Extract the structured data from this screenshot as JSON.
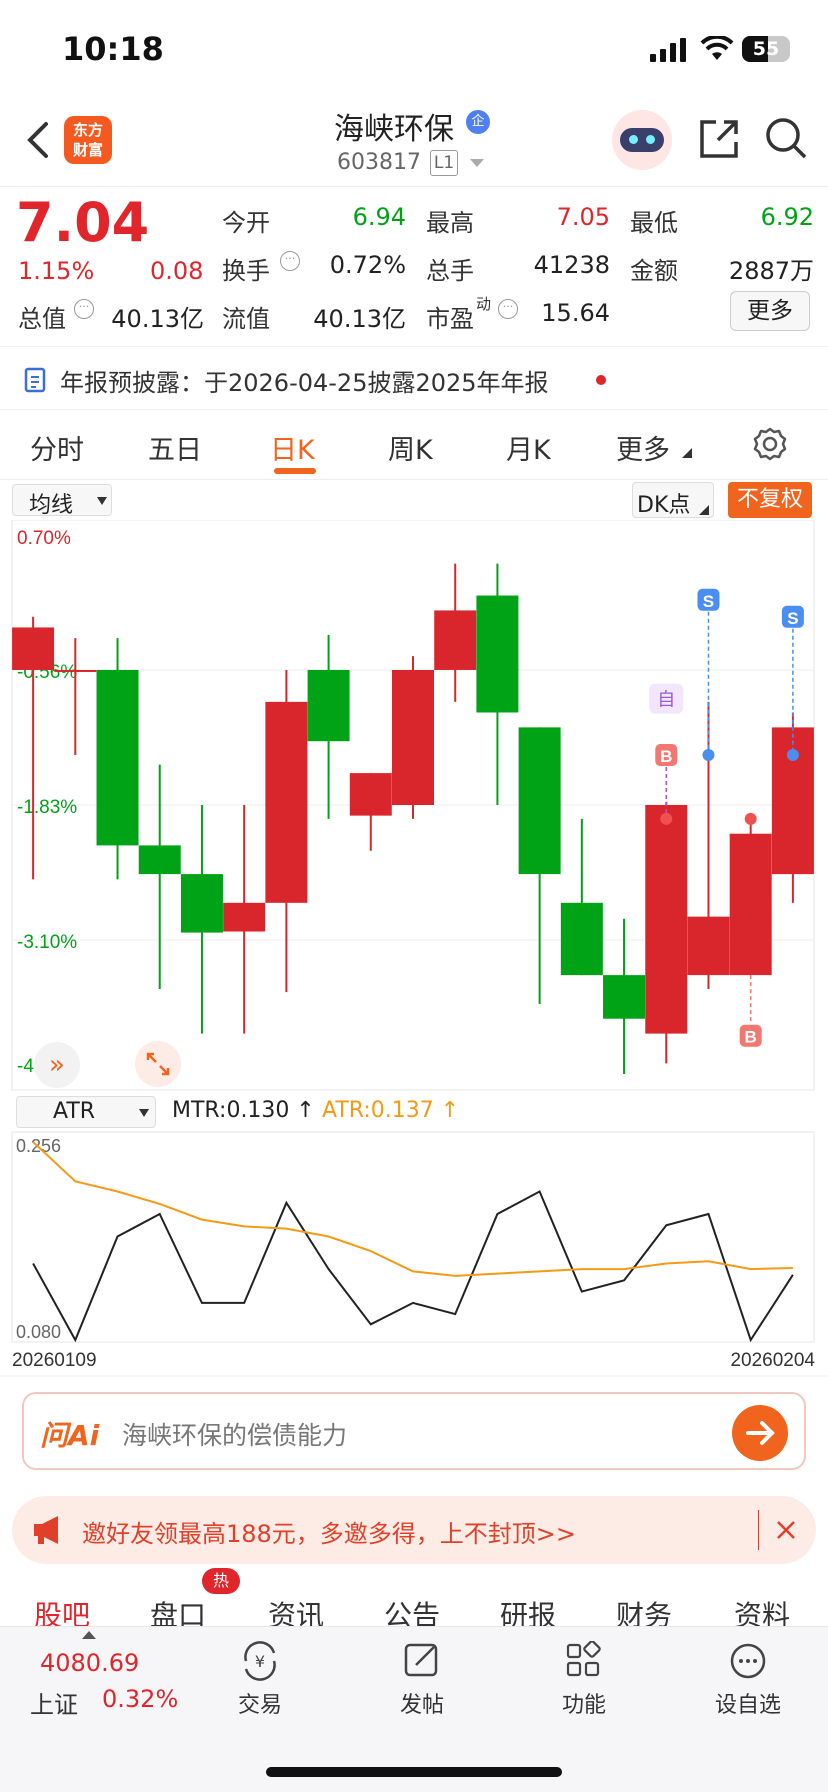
{
  "status_bar": {
    "time": "10:18",
    "battery": "55"
  },
  "header": {
    "stock_name": "海峡环保",
    "badge": "企",
    "code": "603817",
    "level": "L1",
    "logo_line1": "东方",
    "logo_line2": "财富"
  },
  "quote": {
    "price": "7.04",
    "change_pct": "1.15%",
    "change": "0.08",
    "open_label": "今开",
    "open": "6.94",
    "high_label": "最高",
    "high": "7.05",
    "low_label": "最低",
    "low": "6.92",
    "turnover_label": "换手",
    "turnover": "0.72%",
    "volume_label": "总手",
    "volume": "41238",
    "amount_label": "金额",
    "amount": "2887万",
    "mktcap_label": "总值",
    "mktcap": "40.13亿",
    "float_label": "流值",
    "float": "40.13亿",
    "pe_label": "市盈",
    "pe_sup": "动",
    "pe": "15.64",
    "more_button": "更多"
  },
  "notice": {
    "text": "年报预披露：于2026-04-25披露2025年年报"
  },
  "tabs": [
    "分时",
    "五日",
    "日K",
    "周K",
    "月K",
    "更多"
  ],
  "active_tab": "日K",
  "chart_toolbar": {
    "ma_select": "均线",
    "dk_button": "DK点",
    "adjust_button": "不复权"
  },
  "indicator": {
    "select": "ATR",
    "mtr_label": "MTR:0.130",
    "atr_label": "ATR:0.137"
  },
  "signal_labels": {
    "s": "S",
    "b": "B",
    "self": "自"
  },
  "chart_data": [
    {
      "type": "candlestick",
      "y_axis_labels": [
        "0.70%",
        "-0.56%",
        "-1.83%",
        "-3.10%",
        "-4.36%"
      ],
      "ylim": [
        -4.36,
        0.7
      ],
      "candles": [
        {
          "o": -0.56,
          "c": -0.16,
          "h": -0.06,
          "l": -2.53
        },
        {
          "o": -0.56,
          "c": -0.56,
          "h": -0.26,
          "l": -1.36
        },
        {
          "o": -0.56,
          "c": -2.21,
          "h": -0.26,
          "l": -2.53
        },
        {
          "o": -2.21,
          "c": -2.48,
          "h": -1.45,
          "l": -3.56
        },
        {
          "o": -2.48,
          "c": -3.03,
          "h": -1.83,
          "l": -3.98
        },
        {
          "o": -3.02,
          "c": -2.75,
          "h": -1.83,
          "l": -3.98
        },
        {
          "o": -2.75,
          "c": -0.86,
          "h": -0.56,
          "l": -3.59
        },
        {
          "o": -0.56,
          "c": -1.23,
          "h": -0.23,
          "l": -1.96
        },
        {
          "o": -1.93,
          "c": -1.53,
          "h": -1.53,
          "l": -2.26
        },
        {
          "o": -1.83,
          "c": -0.56,
          "h": -0.43,
          "l": -1.96
        },
        {
          "o": -0.56,
          "c": 0.0,
          "h": 0.44,
          "l": -0.86
        },
        {
          "o": 0.14,
          "c": -0.96,
          "h": 0.44,
          "l": -1.83
        },
        {
          "o": -1.1,
          "c": -2.48,
          "h": -1.1,
          "l": -3.7
        },
        {
          "o": -2.75,
          "c": -3.43,
          "h": -1.96,
          "l": -3.43
        },
        {
          "o": -3.43,
          "c": -3.84,
          "h": -2.9,
          "l": -4.36
        },
        {
          "o": -3.98,
          "c": -1.83,
          "h": -1.8,
          "l": -4.26
        },
        {
          "o": -3.43,
          "c": -2.88,
          "h": -0.86,
          "l": -3.56
        },
        {
          "o": -3.43,
          "c": -2.1,
          "h": -1.96,
          "l": -3.43
        },
        {
          "o": -2.48,
          "c": -1.1,
          "h": -0.96,
          "l": -2.75
        }
      ]
    },
    {
      "type": "line",
      "x_start_label": "20260109",
      "x_end_label": "20260204",
      "y_labels": [
        "0.256",
        "0.080"
      ],
      "ylim": [
        0.08,
        0.256
      ],
      "series": [
        {
          "name": "MTR",
          "values": [
            0.148,
            0.08,
            0.172,
            0.192,
            0.113,
            0.113,
            0.202,
            0.143,
            0.094,
            0.113,
            0.103,
            0.192,
            0.212,
            0.123,
            0.133,
            0.182,
            0.192,
            0.08,
            0.138
          ]
        },
        {
          "name": "ATR",
          "values": [
            0.256,
            0.221,
            0.212,
            0.201,
            0.187,
            0.181,
            0.179,
            0.172,
            0.159,
            0.141,
            0.137,
            0.139,
            0.141,
            0.143,
            0.143,
            0.148,
            0.15,
            0.143,
            0.144
          ]
        }
      ]
    }
  ],
  "ai_bar": {
    "logo": "问Ai",
    "placeholder": "海峡环保的偿债能力"
  },
  "invite": {
    "text": "邀好友领最高188元，多邀多得，上不封顶>>"
  },
  "bottom_tabs": [
    "股吧",
    "盘口",
    "资讯",
    "公告",
    "研报",
    "财务",
    "资料"
  ],
  "hot_badge": "热",
  "footer": {
    "index_value": "4080.69",
    "index_name": "上证",
    "index_change": "0.32%",
    "items": [
      "交易",
      "发帖",
      "功能",
      "设自选"
    ]
  }
}
